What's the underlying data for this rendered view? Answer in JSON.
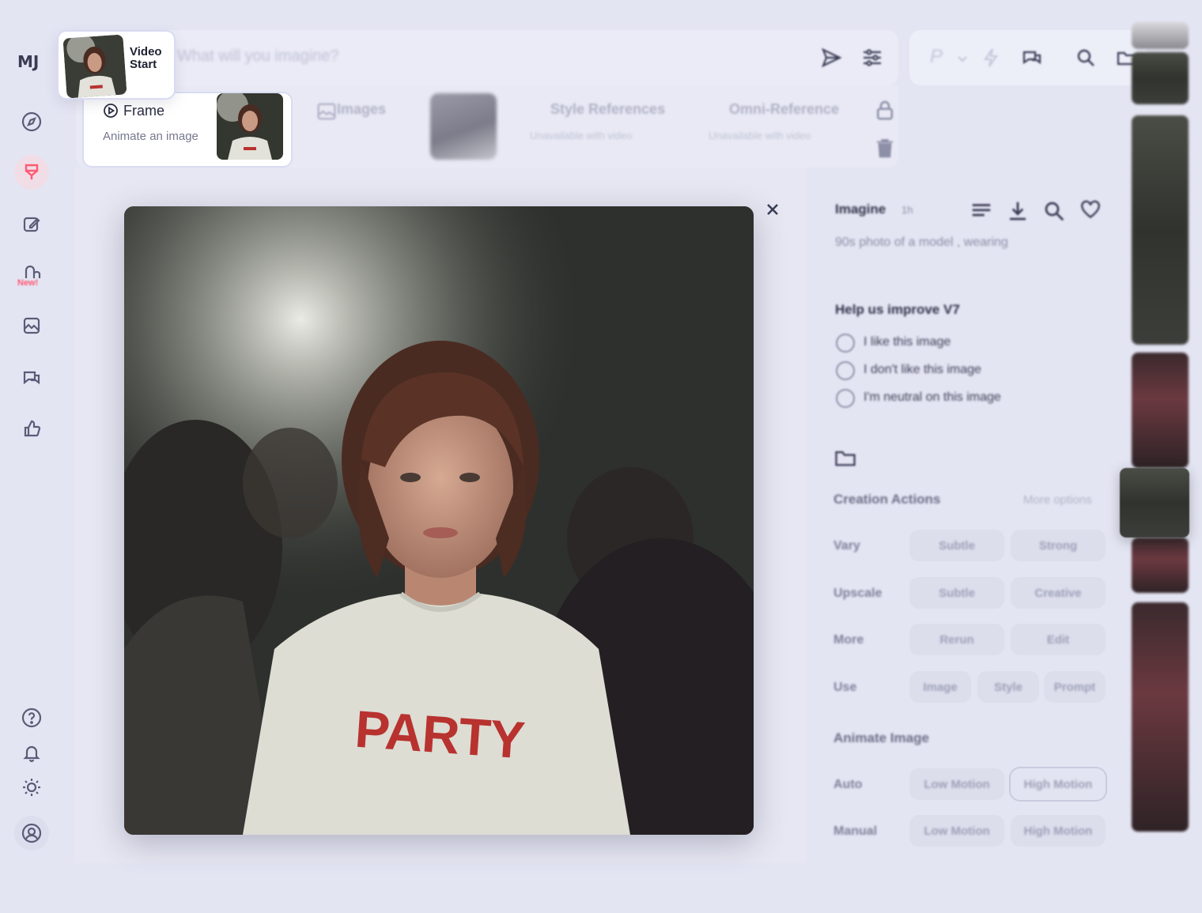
{
  "app": {
    "logo": "MJ",
    "new_badge": "New!"
  },
  "prompt_bar": {
    "placeholder": "What will you imagine?",
    "speed_letter": "P"
  },
  "video_start": {
    "label_line1": "Video",
    "label_line2": "Start"
  },
  "frame_option": {
    "title": "Frame",
    "subtitle": "Animate an image"
  },
  "reference_row": {
    "images_label": "Images",
    "style_label": "Style References",
    "style_sub": "Unavailable with video",
    "omni_label": "Omni-Reference",
    "omni_sub": "Unavailable with video"
  },
  "main_image": {
    "shirt_text": "PARTY"
  },
  "panel": {
    "header": "Imagine",
    "age": "1h",
    "prompt_excerpt": "90s photo of a model , wearing",
    "feedback_title": "Help us improve V7",
    "feedback_options": [
      "I like this image",
      "I don't like this image",
      "I'm neutral on this image"
    ],
    "creation_title": "Creation Actions",
    "more_options": "More options",
    "rows": [
      {
        "label": "Vary",
        "buttons": [
          "Subtle",
          "Strong"
        ]
      },
      {
        "label": "Upscale",
        "buttons": [
          "Subtle",
          "Creative"
        ]
      },
      {
        "label": "More",
        "buttons": [
          "Rerun",
          "Edit"
        ]
      },
      {
        "label": "Use",
        "buttons": [
          "Image",
          "Style",
          "Prompt"
        ]
      }
    ],
    "animate_title": "Animate Image",
    "animate_rows": [
      {
        "label": "Auto",
        "buttons": [
          "Low Motion",
          "High Motion"
        ]
      },
      {
        "label": "Manual",
        "buttons": [
          "Low Motion",
          "High Motion"
        ]
      }
    ]
  },
  "colors": {
    "background": "#e4e5f3",
    "accent_red": "#ff5a73",
    "shirt_print": "#b8322f"
  }
}
